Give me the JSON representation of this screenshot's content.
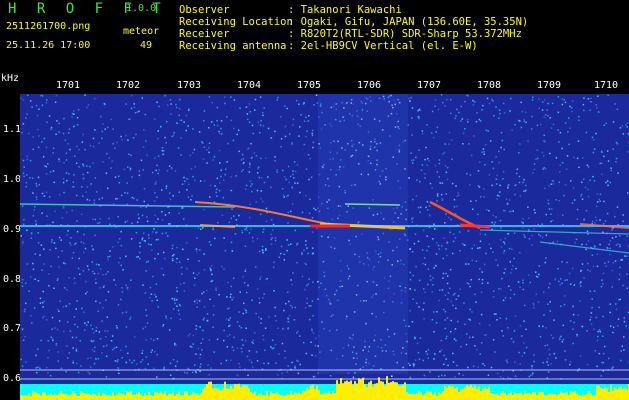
{
  "app": {
    "title": "H R O F F T",
    "version": "1.0.0",
    "file_name": "2511261700.png",
    "date_time": "25.11.26 17:00",
    "meteor_label": "meteor",
    "meteor_count": "49"
  },
  "info": {
    "observer_label": "Observer",
    "observer_value": ": Takanori Kawachi",
    "location_label": "Receiving Location",
    "location_value": ": Ogaki, Gifu, JAPAN (136.60E, 35.35N)",
    "receiver_label": "Receiver",
    "receiver_value": ": R820T2(RTL-SDR) SDR-Sharp 53.372MHz",
    "antenna_label": "Receiving antenna",
    "antenna_value": ": 2el-HB9CV Vertical (el. E-W)"
  },
  "axes": {
    "y_unit": "kHz",
    "y_ticks": [
      "1.1",
      "1.0",
      "0.9",
      "0.8",
      "0.7",
      "0.6"
    ],
    "x_ticks": [
      "1701",
      "1702",
      "1703",
      "1704",
      "1705",
      "1706",
      "1707",
      "1708",
      "1709",
      "1710"
    ]
  },
  "colors": {
    "background_blue": "#1a2a9c",
    "header_green": "#3fe63f",
    "header_yellow": "#ffff00",
    "baseline_cyan": "#00ffff",
    "level_yellow": "#ffee00"
  }
}
